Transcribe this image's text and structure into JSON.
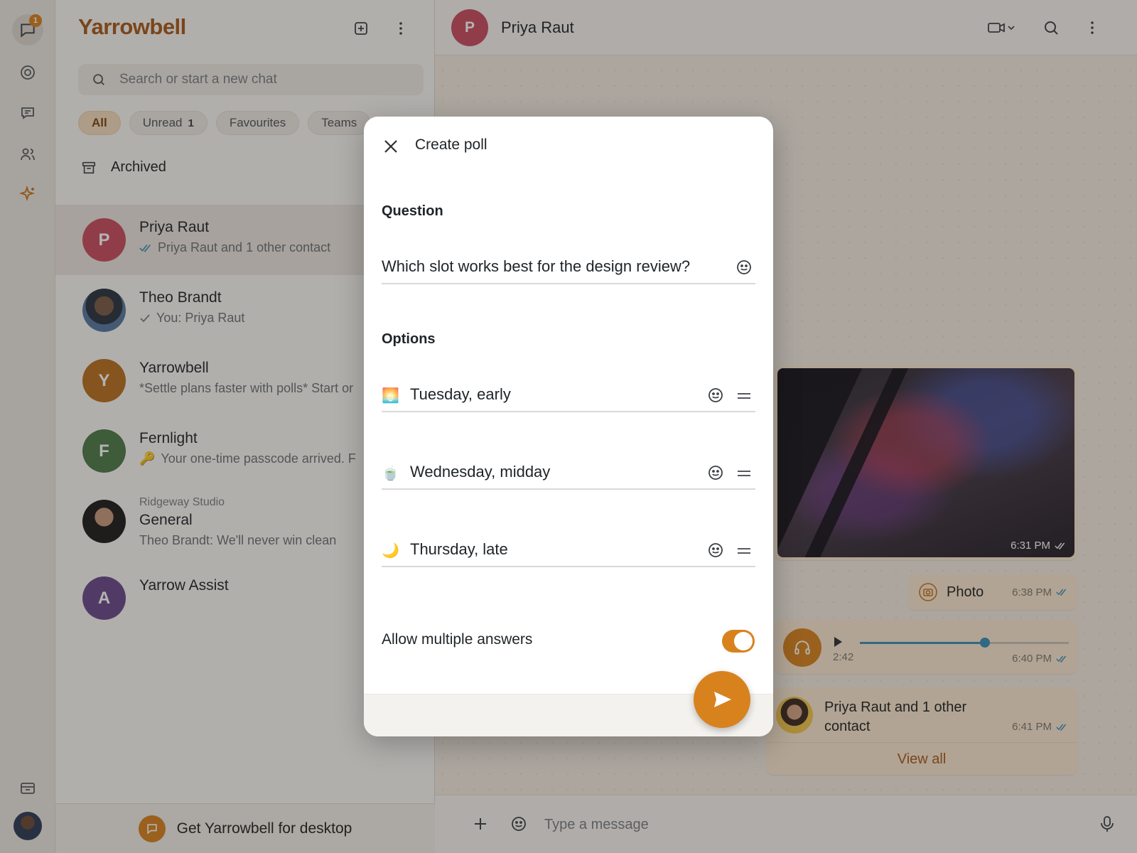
{
  "app": {
    "name": "Yarrowbell"
  },
  "rail": {
    "chats_badge": "1"
  },
  "list": {
    "search_placeholder": "Search or start a new chat",
    "filters": [
      {
        "label": "All",
        "count": ""
      },
      {
        "label": "Unread",
        "count": "1"
      },
      {
        "label": "Favourites",
        "count": ""
      },
      {
        "label": "Teams",
        "count": ""
      }
    ],
    "archived_label": "Archived",
    "chats": [
      {
        "initial": "P",
        "name": "Priya Raut",
        "preview": "Priya Raut and 1 other contact",
        "color": "#c84c60"
      },
      {
        "initial": "",
        "name": "Theo Brandt",
        "preview": "You: Priya Raut"
      },
      {
        "initial": "Y",
        "name": "Yarrowbell",
        "preview": "*Settle plans faster with polls* Start or",
        "color": "#b9701f"
      },
      {
        "initial": "F",
        "name": "Fernlight",
        "preview": "Your one-time passcode arrived. F",
        "preview_emoji": "🔑",
        "color": "#4d7a4a"
      },
      {
        "initial": "",
        "org": "Ridgeway Studio",
        "name": "General",
        "preview": "Theo Brandt: We'll never win clean"
      },
      {
        "initial": "A",
        "name": "Yarrow Assist",
        "preview": "",
        "color": "#6a4a8c"
      }
    ],
    "desktop_promo": "Get Yarrowbell for desktop"
  },
  "conversation": {
    "contact_initial": "P",
    "contact_name": "Priya Raut",
    "messages": {
      "image_time": "6:31 PM",
      "photo_label": "Photo",
      "photo_time": "6:38 PM",
      "audio_duration": "2:42",
      "audio_progress": 0.6,
      "audio_time": "6:40 PM",
      "contact_card_name": "Priya Raut and 1 other contact",
      "contact_card_time": "6:41 PM",
      "view_all": "View all"
    },
    "composer_placeholder": "Type a message"
  },
  "poll_modal": {
    "title": "Create poll",
    "question_label": "Question",
    "question_value": "Which slot works best for the design review?",
    "options_label": "Options",
    "options": [
      {
        "emoji": "🌅",
        "text": "Tuesday, early"
      },
      {
        "emoji": "🍵",
        "text": "Wednesday, midday"
      },
      {
        "emoji": "🌙",
        "text": "Thursday, late"
      }
    ],
    "allow_multiple_label": "Allow multiple answers",
    "allow_multiple": true
  },
  "colors": {
    "accent": "#d8821e",
    "brand": "#a8581a",
    "read_tick": "#3a8fb7"
  }
}
